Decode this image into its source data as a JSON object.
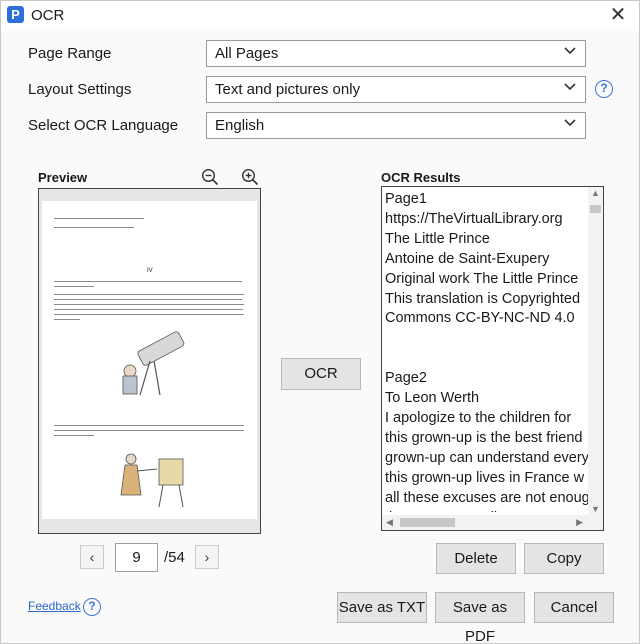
{
  "window": {
    "title": "OCR",
    "logo_letter": "P"
  },
  "settings": {
    "page_range": {
      "label": "Page Range",
      "value": "All Pages"
    },
    "layout": {
      "label": "Layout Settings",
      "value": "Text and pictures only"
    },
    "language": {
      "label": "Select OCR Language",
      "value": "English"
    }
  },
  "preview": {
    "title": "Preview",
    "page_heading": "IV",
    "current_page": "9",
    "total_pages": "/54"
  },
  "ocr_button": "OCR",
  "results": {
    "title": "OCR Results",
    "lines": [
      "Page1",
      "https://TheVirtualLibrary.org",
      "The Little Prince",
      "Antoine de Saint-Exupery",
      "Original work The Little Prince",
      "This translation is Copyrighted",
      "Commons CC-BY-NC-ND 4.0",
      "",
      "",
      "Page2",
      "To Leon Werth",
      "I apologize to the children for",
      "this grown-up is the best friend",
      "grown-up can understand every",
      "this grown-up lives in France w",
      "all these excuses are not enoug",
      "that grown-up. All"
    ]
  },
  "buttons": {
    "delete": "Delete",
    "copy": "Copy",
    "save_txt": "Save as TXT",
    "save_pdf": "Save as PDF",
    "cancel": "Cancel"
  },
  "feedback": "Feedback",
  "icons": {
    "help": "?",
    "close": "✕",
    "prev": "‹",
    "next": "›"
  },
  "colors": {
    "accent": "#3a76d8",
    "link": "#2a65c9",
    "button_bg": "#e4e4e4"
  }
}
